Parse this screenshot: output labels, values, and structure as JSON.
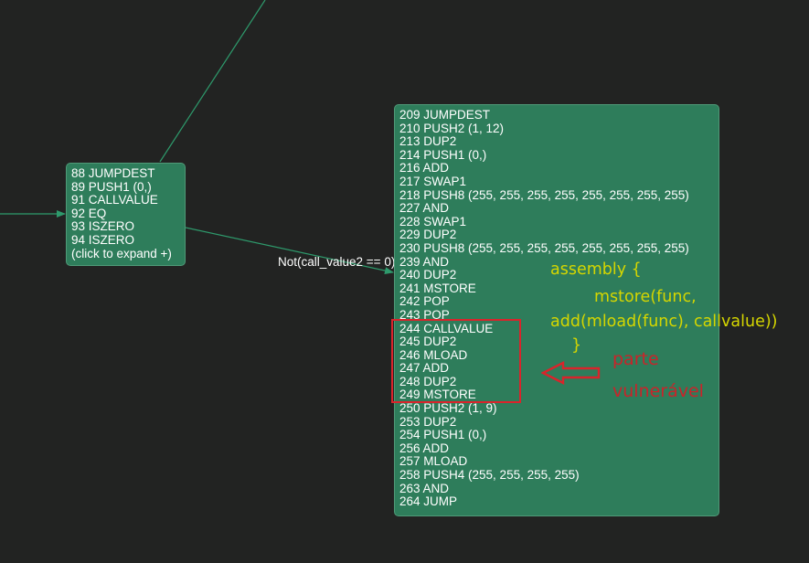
{
  "graph": {
    "node_left": {
      "lines": [
        "88 JUMPDEST",
        "89 PUSH1 (0,)",
        "91 CALLVALUE",
        "92 EQ",
        "93 ISZERO",
        "94 ISZERO",
        "(click to expand +)"
      ]
    },
    "node_right": {
      "lines": [
        "209 JUMPDEST",
        "210 PUSH2 (1, 12)",
        "213 DUP2",
        "214 PUSH1 (0,)",
        "216 ADD",
        "217 SWAP1",
        "218 PUSH8 (255, 255, 255, 255, 255, 255, 255, 255)",
        "227 AND",
        "228 SWAP1",
        "229 DUP2",
        "230 PUSH8 (255, 255, 255, 255, 255, 255, 255, 255)",
        "239 AND",
        "240 DUP2",
        "241 MSTORE",
        "242 POP",
        "243 POP",
        "244 CALLVALUE",
        "245 DUP2",
        "246 MLOAD",
        "247 ADD",
        "248 DUP2",
        "249 MSTORE",
        "250 PUSH2 (1, 9)",
        "253 DUP2",
        "254 PUSH1 (0,)",
        "256 ADD",
        "257 MLOAD",
        "258 PUSH4 (255, 255, 255, 255)",
        "263 AND",
        "264 JUMP"
      ]
    },
    "edge_label": "Not(call_value2 == 0)"
  },
  "annotation": {
    "code_lines": [
      "assembly {",
      "mstore(func,",
      "add(mload(func), callvalue))",
      "}"
    ],
    "label_lines": [
      "parte",
      "vulnerável"
    ]
  },
  "colors": {
    "background": "#222322",
    "node_fill": "#2e7d5b",
    "edge": "#2e9a6c",
    "highlight": "#d9242b",
    "annotation_green": "#d5d600",
    "annotation_red": "#c9242a"
  }
}
